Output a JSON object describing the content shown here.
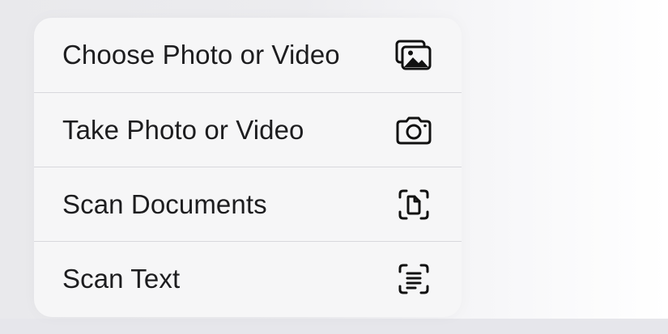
{
  "menu": {
    "items": [
      {
        "label": "Choose Photo or Video",
        "icon": "photo-library-icon"
      },
      {
        "label": "Take Photo or Video",
        "icon": "camera-icon"
      },
      {
        "label": "Scan Documents",
        "icon": "document-scanner-icon"
      },
      {
        "label": "Scan Text",
        "icon": "text-scanner-icon"
      }
    ]
  }
}
